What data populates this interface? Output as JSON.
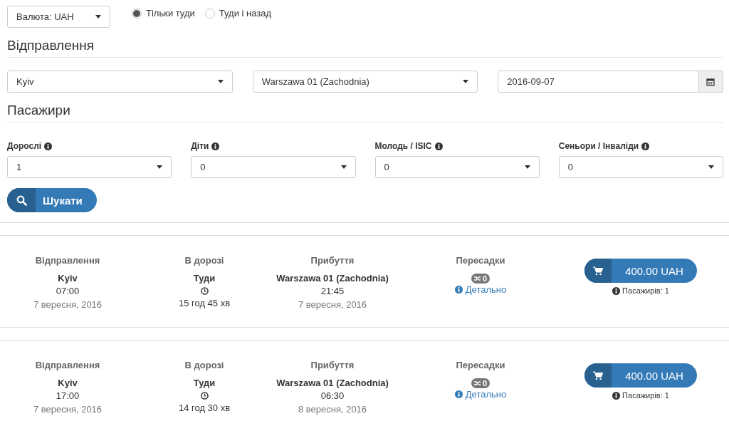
{
  "currency": {
    "value": "Валюта: UAH"
  },
  "trip_type": [
    {
      "label": "Тільки туди",
      "selected": true
    },
    {
      "label": "Туди і назад",
      "selected": false
    }
  ],
  "departure": {
    "heading": "Відправлення",
    "from": "Kyiv",
    "to": "Warszawa 01 (Zachodnia)",
    "date": "2016-09-07"
  },
  "passengers": {
    "heading": "Пасажири",
    "groups": [
      {
        "label": "Дорослі",
        "value": "1"
      },
      {
        "label": "Діти",
        "value": "0"
      },
      {
        "label": "Молодь / ISIC",
        "value": "0"
      },
      {
        "label": "Сеньори / Інваліди",
        "value": "0"
      }
    ]
  },
  "search_button": "Шукати",
  "results": [
    {
      "departure_label": "Відправлення",
      "from": "Kyiv",
      "dep_time": "07:00",
      "dep_date": "7 вересня, 2016",
      "travel_label": "В дорозі",
      "direction": "Туди",
      "duration": "15 год 45 хв",
      "arrival_label": "Прибуття",
      "to": "Warszawa 01 (Zachodnia)",
      "arr_time": "21:45",
      "arr_date": "7 вересня, 2016",
      "transfers_label": "Пересадки",
      "transfers": "0",
      "details": "Детально",
      "price": "400.00 UAH",
      "passengers": "Пасажирів: 1"
    },
    {
      "departure_label": "Відправлення",
      "from": "Kyiv",
      "dep_time": "17:00",
      "dep_date": "7 вересня, 2016",
      "travel_label": "В дорозі",
      "direction": "Туди",
      "duration": "14 год 30 хв",
      "arrival_label": "Прибуття",
      "to": "Warszawa 01 (Zachodnia)",
      "arr_time": "06:30",
      "arr_date": "8 вересня, 2016",
      "transfers_label": "Пересадки",
      "transfers": "0",
      "details": "Детально",
      "price": "400.00 UAH",
      "passengers": "Пасажирів: 1"
    }
  ]
}
